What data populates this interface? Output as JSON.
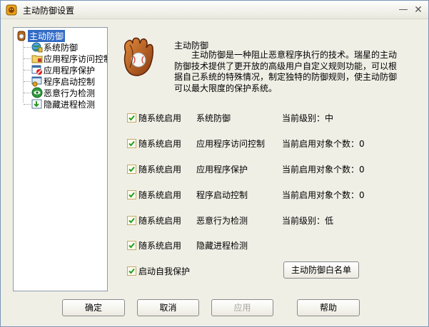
{
  "window": {
    "title": "主动防御设置"
  },
  "tree": {
    "root_label": "主动防御",
    "items": [
      {
        "label": "系统防御",
        "icon": "globe-shield-icon"
      },
      {
        "label": "应用程序访问控制",
        "icon": "folder-lock-icon"
      },
      {
        "label": "应用程序保护",
        "icon": "shield-deny-icon"
      },
      {
        "label": "程序启动控制",
        "icon": "program-launch-icon"
      },
      {
        "label": "恶意行为检测",
        "icon": "scan-eye-icon"
      },
      {
        "label": "隐藏进程检测",
        "icon": "download-process-icon"
      }
    ]
  },
  "description": {
    "title": "主动防御",
    "body": "主动防御是一种阻止恶意程序执行的技术。瑞星的主动防御技术提供了更开放的高级用户自定义规则功能，可以根据自己系统的特殊情况，制定独特的防御规则，使主动防御可以最大限度的保护系统。"
  },
  "rows": [
    {
      "checked": true,
      "label": "随系统启用",
      "feature": "系统防御",
      "status": "当前级别：中"
    },
    {
      "checked": true,
      "label": "随系统启用",
      "feature": "应用程序访问控制",
      "status": "当前启用对象个数：0"
    },
    {
      "checked": true,
      "label": "随系统启用",
      "feature": "应用程序保护",
      "status": "当前启用对象个数：0"
    },
    {
      "checked": true,
      "label": "随系统启用",
      "feature": "程序启动控制",
      "status": "当前启用对象个数：0"
    },
    {
      "checked": true,
      "label": "随系统启用",
      "feature": "恶意行为检测",
      "status": "当前级别：低"
    },
    {
      "checked": true,
      "label": "随系统启用",
      "feature": "隐藏进程检测",
      "status": ""
    }
  ],
  "self_protect": {
    "checked": true,
    "label": "启动自我保护"
  },
  "whitelist_button": "主动防御白名单",
  "buttons": {
    "ok": "确定",
    "cancel": "取消",
    "apply": "应用",
    "help": "帮助"
  },
  "colors": {
    "selection": "#316ac5",
    "dialog_bg": "#f0efe6",
    "checkmark": "#21a121"
  }
}
